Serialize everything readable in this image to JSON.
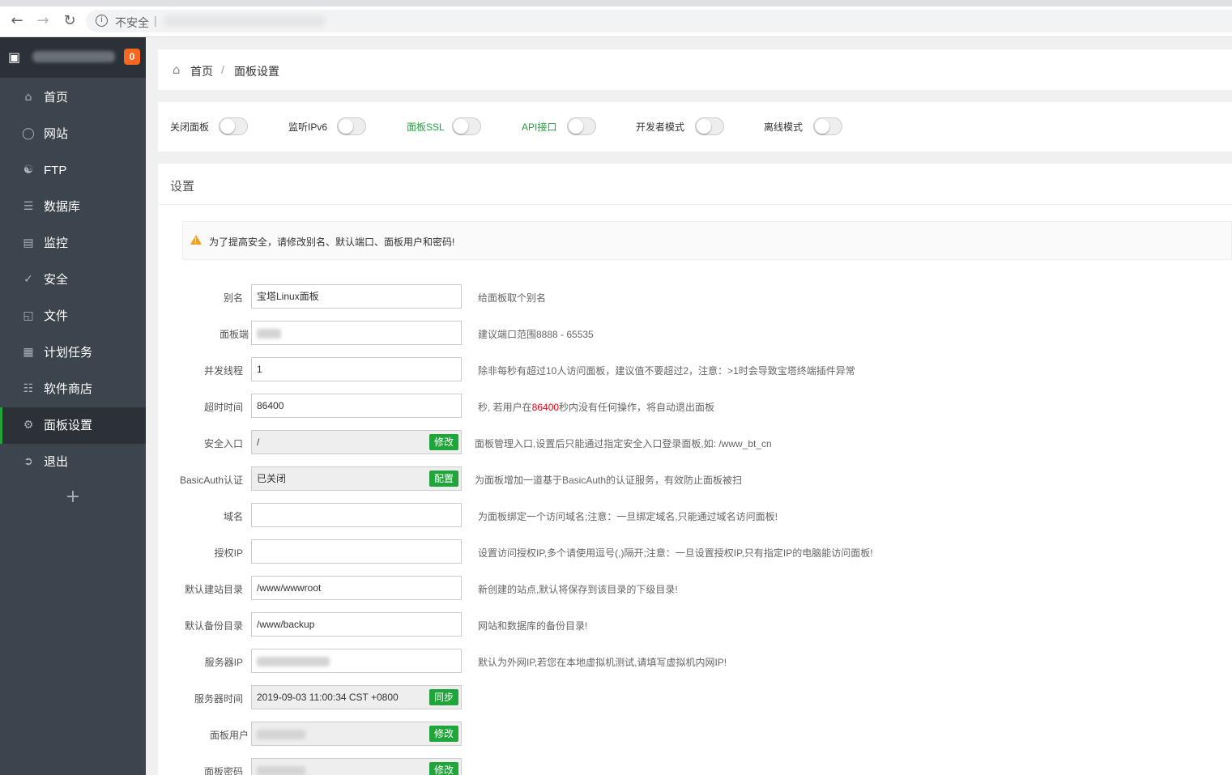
{
  "browser": {
    "back_icon": "back-arrow-icon",
    "forward_icon": "forward-arrow-icon",
    "reload_icon": "reload-icon",
    "security_label": "不安全",
    "separator": "|"
  },
  "sidebar": {
    "badge": "0",
    "items": [
      {
        "label": "首页",
        "icon": "home-icon"
      },
      {
        "label": "网站",
        "icon": "globe-icon"
      },
      {
        "label": "FTP",
        "icon": "ftp-icon"
      },
      {
        "label": "数据库",
        "icon": "database-icon"
      },
      {
        "label": "监控",
        "icon": "monitor-chart-icon"
      },
      {
        "label": "安全",
        "icon": "shield-icon"
      },
      {
        "label": "文件",
        "icon": "folder-icon"
      },
      {
        "label": "计划任务",
        "icon": "calendar-icon"
      },
      {
        "label": "软件商店",
        "icon": "grid-apps-icon"
      },
      {
        "label": "面板设置",
        "icon": "gear-icon",
        "active": true
      },
      {
        "label": "退出",
        "icon": "logout-icon"
      }
    ],
    "add_symbol": "+"
  },
  "breadcrumb": {
    "home": "首页",
    "separator": "/",
    "current": "面板设置"
  },
  "toggles": [
    {
      "label": "关闭面板",
      "on": false,
      "highlight": false
    },
    {
      "label": "监听IPv6",
      "on": false,
      "highlight": false
    },
    {
      "label": "面板SSL",
      "on": false,
      "highlight": true
    },
    {
      "label": "API接口",
      "on": false,
      "highlight": true
    },
    {
      "label": "开发者模式",
      "on": false,
      "highlight": false
    },
    {
      "label": "离线模式",
      "on": false,
      "highlight": false
    }
  ],
  "settings": {
    "title": "设置",
    "warning": "为了提高安全，请修改别名、默认端口、面板用户和密码!",
    "rows": {
      "alias": {
        "label": "别名",
        "value": "宝塔Linux面板",
        "hint": "给面板取个别名"
      },
      "port": {
        "label": "面板端",
        "value": "",
        "hint": "建议端口范围8888 - 65535"
      },
      "threads": {
        "label": "并发线程",
        "value": "1",
        "hint": "除非每秒有超过10人访问面板，建议值不要超过2，注意：>1时会导致宝塔终端插件异常"
      },
      "timeout": {
        "label": "超时时间",
        "value": "86400",
        "hint_pre": "秒, 若用户在",
        "hint_red": "86400",
        "hint_post": "秒内没有任何操作，将自动退出面板"
      },
      "entry": {
        "label": "安全入口",
        "value": "/",
        "button": "修改",
        "hint": "面板管理入口,设置后只能通过指定安全入口登录面板,如: /www_bt_cn"
      },
      "basicauth": {
        "label": "BasicAuth认证",
        "value": "已关闭",
        "button": "配置",
        "hint": "为面板增加一道基于BasicAuth的认证服务，有效防止面板被扫"
      },
      "domain": {
        "label": "域名",
        "value": "",
        "hint": "为面板绑定一个访问域名;注意：一旦绑定域名,只能通过域名访问面板!"
      },
      "auth_ip": {
        "label": "授权IP",
        "value": "",
        "hint": "设置访问授权IP,多个请使用逗号(,)隔开;注意：一旦设置授权IP,只有指定IP的电脑能访问面板!"
      },
      "site_dir": {
        "label": "默认建站目录",
        "value": "/www/wwwroot",
        "hint": "新创建的站点,默认将保存到该目录的下级目录!"
      },
      "backup_dir": {
        "label": "默认备份目录",
        "value": "/www/backup",
        "hint": "网站和数据库的备份目录!"
      },
      "server_ip": {
        "label": "服务器IP",
        "value": "",
        "hint": "默认为外网IP,若您在本地虚拟机测试,请填写虚拟机内网IP!"
      },
      "server_time": {
        "label": "服务器时间",
        "value": "2019-09-03 11:00:34 CST +0800",
        "button": "同步"
      },
      "panel_user": {
        "label": "面板用户",
        "value": "",
        "button": "修改"
      },
      "panel_pass": {
        "label": "面板密码",
        "value": "",
        "button": "修改"
      }
    }
  }
}
